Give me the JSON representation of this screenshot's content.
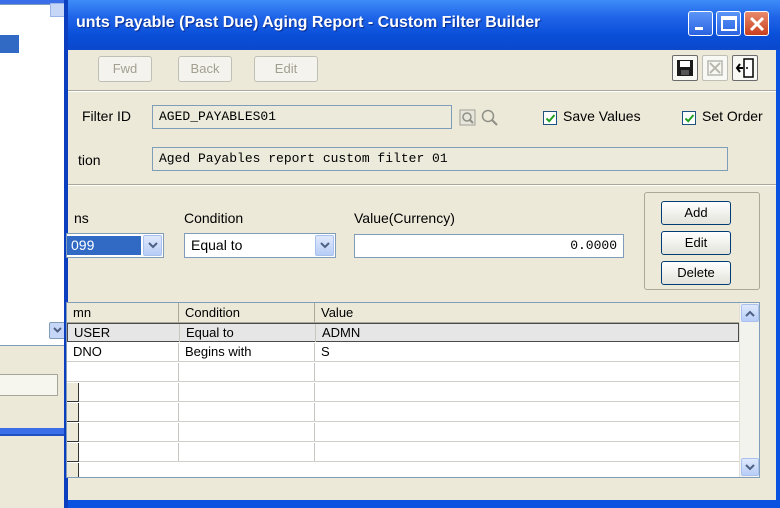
{
  "window": {
    "title": "unts Payable (Past Due) Aging Report - Custom Filter Builder",
    "min_glyph": "_",
    "max_glyph": "□",
    "close_glyph": "✕"
  },
  "toolbar": {
    "fwd_label": "Fwd",
    "back_label": "Back",
    "edit_label": "Edit",
    "icons": [
      "save-disk-icon",
      "cancel-filter-icon",
      "exit-door-icon"
    ]
  },
  "filter": {
    "id_label": "Filter ID",
    "id_value": "AGED_PAYABLES01",
    "save_values_label": "Save Values",
    "save_values_checked": true,
    "set_order_label": "Set Order",
    "set_order_checked": true,
    "description_label": "tion",
    "description_value": "Aged Payables report custom filter 01"
  },
  "editor": {
    "columns_label": "ns",
    "columns_value": "099",
    "condition_label": "Condition",
    "condition_value": "Equal to",
    "value_label": "Value(Currency)",
    "value_value": "0.0000",
    "add_label": "Add",
    "edit_label": "Edit",
    "delete_label": "Delete"
  },
  "grid": {
    "headers": [
      "mn",
      "Condition",
      "Value"
    ],
    "rows": [
      {
        "column": "USER",
        "condition": "Equal to",
        "value": "ADMN",
        "selected": true
      },
      {
        "column": "DNO",
        "condition": "Begins with",
        "value": "S",
        "selected": false
      }
    ]
  },
  "colors": {
    "title_bar": "#0a53e0",
    "selection": "#316ac5",
    "face": "#ece9d8"
  }
}
